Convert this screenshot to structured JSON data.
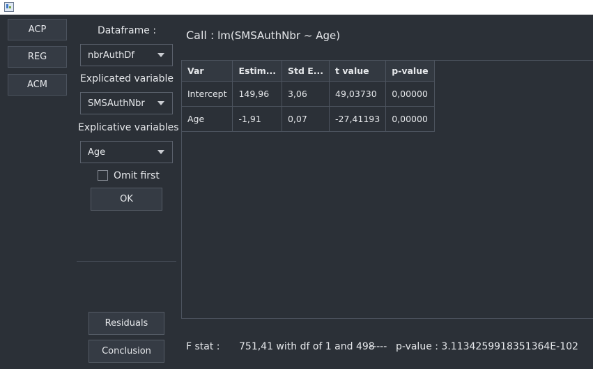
{
  "window": {
    "icon": "app-icon"
  },
  "nav": {
    "acp": "ACP",
    "reg": "REG",
    "acm": "ACM"
  },
  "form": {
    "dataframe_label": "Dataframe :",
    "dataframe_value": "nbrAuthDf",
    "explicated_label": "Explicated variable",
    "explicated_value": "SMSAuthNbr",
    "explicative_label": "Explicative variables",
    "explicative_value": "Age",
    "omit_first_label": "Omit first",
    "omit_first_checked": false,
    "ok_label": "OK"
  },
  "actions": {
    "residuals": "Residuals",
    "conclusion": "Conclusion"
  },
  "call": {
    "label": "Call :",
    "formula": "lm(SMSAuthNbr ~ Age)"
  },
  "table": {
    "headers": [
      "Var",
      "Estim...",
      "Std E...",
      "t value",
      "p-value"
    ],
    "rows": [
      [
        "Intercept",
        "149,96",
        "3,06",
        "49,03730",
        "0,00000"
      ],
      [
        "Age",
        "-1,91",
        "0,07",
        "-27,41193",
        "0,00000"
      ]
    ]
  },
  "footer": {
    "fstat_label": "F stat :",
    "fstat_value": "751,41 with df of 1 and 498",
    "separator": "-----",
    "pvalue": "p-value : 3.1134259918351364E-102"
  }
}
